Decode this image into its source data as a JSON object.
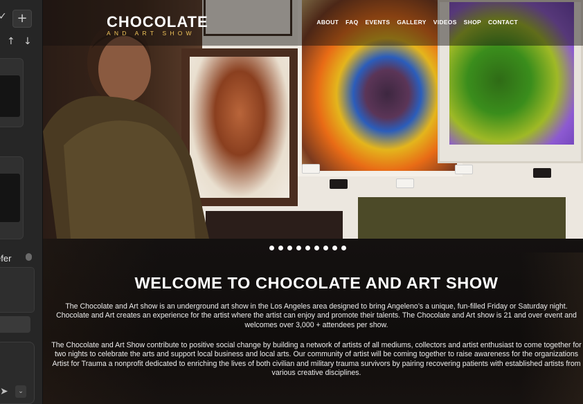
{
  "left_panel": {
    "check_glyph": "✓",
    "add_glyph": "+",
    "arrow_up": "↑",
    "arrow_down": "↓",
    "card_menu": "•••",
    "label": "efer",
    "send_glyph": "➤",
    "dropdown_glyph": "⌄"
  },
  "site": {
    "logo": {
      "main": "CHOCOLATE",
      "sub": "AND ART SHOW"
    },
    "nav": [
      "ABOUT",
      "FAQ",
      "EVENTS",
      "GALLERY",
      "VIDEOS",
      "SHOP",
      "CONTACT"
    ],
    "slider_dot_count": 9,
    "heading": "WELCOME TO CHOCOLATE AND ART SHOW",
    "paragraph1": "The Chocolate and Art show is an underground art show in the Los Angeles area designed to bring Angeleno’s a unique, fun-filled Friday or Saturday night. Chocolate and Art creates an experience for the artist where the artist can enjoy and promote their talents. The Chocolate and Art show is 21 and over event and welcomes over 3,000 + attendees per show.",
    "paragraph2": "The Chocolate and Art Show contribute to positive social change by building a network of artists of all mediums, collectors and artist enthusiast to come together for two nights to celebrate the arts and support local business and local arts. Our community of artist will be coming together to raise awareness for the organizations Artist for Trauma a nonprofit dedicated to enriching the lives of both civilian and military trauma survivors by pairing recovering patients with established artists from various creative disciplines."
  },
  "colors": {
    "logo_accent": "#f0c45a",
    "panel_bg": "#262626",
    "site_bg": "#0d0b0a"
  }
}
